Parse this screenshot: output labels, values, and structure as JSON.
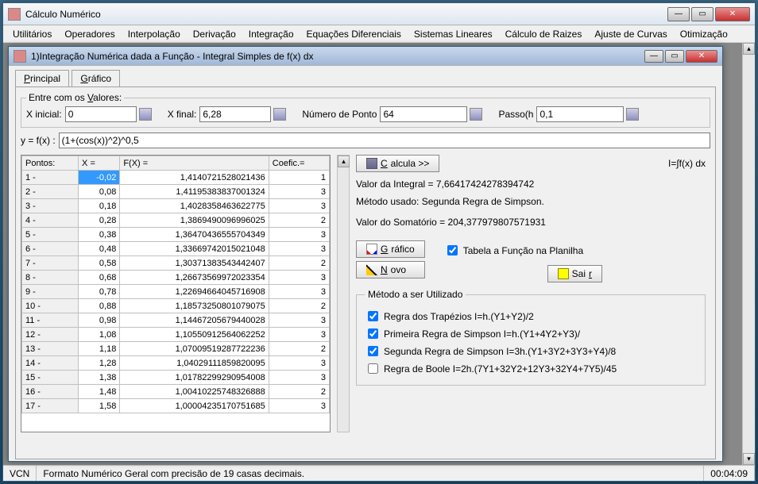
{
  "outer": {
    "title": "Cálculo Numérico",
    "menu": [
      "Utilitários",
      "Operadores",
      "Interpolação",
      "Derivação",
      "Integração",
      "Equações Diferenciais",
      "Sistemas Lineares",
      "Cálculo de Raizes",
      "Ajuste de Curvas",
      "Otimização"
    ]
  },
  "inner": {
    "title": "1)Integração Numérica dada a Função - Integral Simples de f(x) dx",
    "tabs": {
      "principal": "Principal",
      "grafico": "Gráfico"
    },
    "fieldset_legend": "Entre com os Valores:",
    "labels": {
      "x_inicial": "X inicial:",
      "x_final": "X final:",
      "num_pontos": "Número de Ponto",
      "passo": "Passo(h",
      "fx": "y = f(x) :"
    },
    "values": {
      "x_inicial": "0",
      "x_final": "6,28",
      "num_pontos": "64",
      "passo": "0,1",
      "fx": "(1+(cos(x))^2)^0,5"
    },
    "table": {
      "headers": [
        "Pontos:",
        "X =",
        "F(X) =",
        "Coefic.="
      ],
      "rows": [
        [
          "1 -",
          "-0,02",
          "1,4140721528021436",
          "1"
        ],
        [
          "2 -",
          "0,08",
          "1,41195383837001324",
          "3"
        ],
        [
          "3 -",
          "0,18",
          "1,4028358463622775",
          "3"
        ],
        [
          "4 -",
          "0,28",
          "1,3869490096996025",
          "2"
        ],
        [
          "5 -",
          "0,38",
          "1,36470436555704349",
          "3"
        ],
        [
          "6 -",
          "0,48",
          "1,33669742015021048",
          "3"
        ],
        [
          "7 -",
          "0,58",
          "1,30371383543442407",
          "2"
        ],
        [
          "8 -",
          "0,68",
          "1,26673569972023354",
          "3"
        ],
        [
          "9 -",
          "0,78",
          "1,22694664045716908",
          "3"
        ],
        [
          "10 -",
          "0,88",
          "1,18573250801079075",
          "2"
        ],
        [
          "11 -",
          "0,98",
          "1,14467205679440028",
          "3"
        ],
        [
          "12 -",
          "1,08",
          "1,10550912564062252",
          "3"
        ],
        [
          "13 -",
          "1,18",
          "1,07009519287722236",
          "2"
        ],
        [
          "14 -",
          "1,28",
          "1,04029111859820095",
          "3"
        ],
        [
          "15 -",
          "1,38",
          "1,01782299290954008",
          "3"
        ],
        [
          "16 -",
          "1,48",
          "1,00410225748326888",
          "2"
        ],
        [
          "17 -",
          "1,58",
          "1,00004235170751685",
          "3"
        ]
      ]
    },
    "calc_btn": "Calcula >>",
    "integral_label": "I=∫f(x) dx",
    "result1": "Valor da Integral = 7,66417424278394742",
    "result2": "Método usado: Segunda Regra de Simpson.",
    "result3": "Valor do Somatório = 204,377979807571931",
    "btn_grafico": "Gráfico",
    "btn_novo": "Novo",
    "chk_tabela": "Tabela a Função na Planilha",
    "btn_sair": "Sair",
    "methods_legend": "Método a ser Utilizado",
    "methods": {
      "m1": "Regra dos Trapézios I=h.(Y1+Y2)/2",
      "m2": "Primeira Regra de Simpson I=h.(Y1+4Y2+Y3)/",
      "m3": "Segunda Regra de Simpson I=3h.(Y1+3Y2+3Y3+Y4)/8",
      "m4": "Regra de Boole I=2h.(7Y1+32Y2+12Y3+32Y4+7Y5)/45"
    }
  },
  "status": {
    "seg1": "VCN",
    "seg2": "Formato Numérico Geral com precisão de 19 casas decimais.",
    "time": "00:04:09"
  }
}
